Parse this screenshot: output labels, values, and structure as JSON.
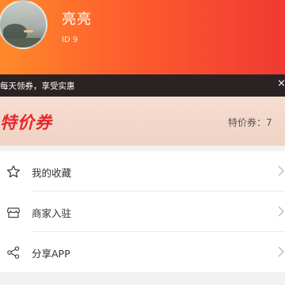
{
  "profile": {
    "name": "亮亮",
    "id_text": "ID 9"
  },
  "promo": {
    "text": "每天领券，享受实惠",
    "close_symbol": "×"
  },
  "coupon": {
    "title": "特价券",
    "count_text": "特价券：7"
  },
  "menu": {
    "items": [
      {
        "label": "我的收藏",
        "icon": "star-icon"
      },
      {
        "label": "商家入驻",
        "icon": "store-icon"
      },
      {
        "label": "分享APP",
        "icon": "share-icon"
      }
    ]
  },
  "colors": {
    "header_gradient_start": "#ff8a2a",
    "header_gradient_end": "#f03a32",
    "promo_bar_bg": "#2b2323",
    "coupon_title": "#e8262a"
  }
}
